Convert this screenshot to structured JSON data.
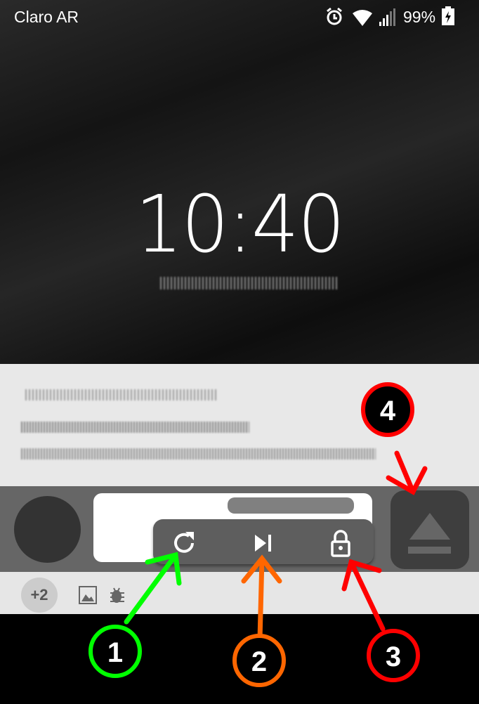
{
  "status_bar": {
    "carrier": "Claro AR",
    "battery": "99%",
    "icons": [
      "alarm-icon",
      "wifi-icon",
      "signal-icon",
      "battery-charging-icon"
    ]
  },
  "lockscreen": {
    "time": "10:40"
  },
  "notification": {
    "more_count": "+2",
    "icons": [
      "image-icon",
      "bug-icon"
    ],
    "actions": [
      {
        "icon": "refresh-icon"
      },
      {
        "icon": "skip-next-icon"
      },
      {
        "icon": "lock-icon"
      }
    ],
    "eject_icon": "eject-icon"
  },
  "annotations": [
    {
      "label": "1",
      "color": "#00ff00"
    },
    {
      "label": "2",
      "color": "#ff6600"
    },
    {
      "label": "3",
      "color": "#ff0000"
    },
    {
      "label": "4",
      "color": "#ff0000"
    }
  ]
}
